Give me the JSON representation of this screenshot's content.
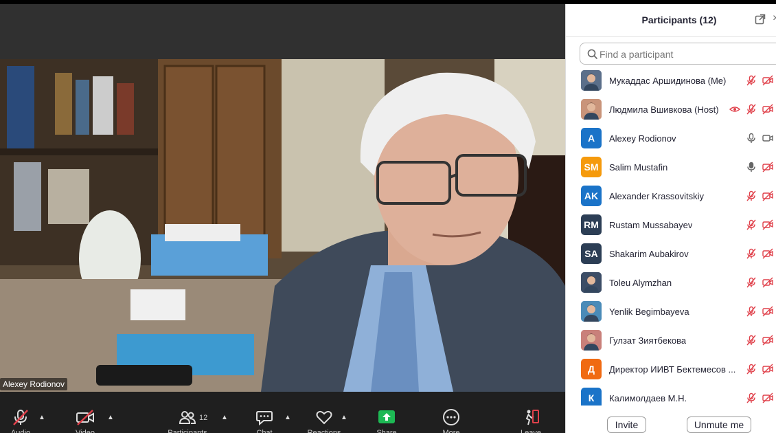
{
  "video": {
    "speaker_name": "Alexey Rodionov"
  },
  "toolbar": {
    "audio_label": "Audio",
    "video_label": "Video",
    "participants_label": "Participants",
    "participants_count": "12",
    "chat_label": "Chat",
    "reactions_label": "Reactions",
    "share_label": "Share",
    "more_label": "More",
    "leave_label": "Leave"
  },
  "panel": {
    "title": "Participants (12)",
    "search_placeholder": "Find a participant",
    "invite_label": "Invite",
    "unmute_label": "Unmute me"
  },
  "participants": [
    {
      "name": "Мукаддас Аршидинова (Me)",
      "avatar": "photo",
      "initials": "",
      "color": "#5b6f8a",
      "mic": "muted",
      "cam": "off"
    },
    {
      "name": "Людмила Вшивкова (Host)",
      "avatar": "photo",
      "initials": "",
      "color": "#c9947a",
      "mic": "muted",
      "cam": "off",
      "extra": "eye"
    },
    {
      "name": "Alexey Rodionov",
      "avatar": "initials",
      "initials": "A",
      "color": "#1a73c8",
      "mic": "on",
      "cam": "on"
    },
    {
      "name": "Salim Mustafin",
      "avatar": "initials",
      "initials": "SM",
      "color": "#f59a0c",
      "mic": "on",
      "cam": "off"
    },
    {
      "name": "Alexander Krassovitskiy",
      "avatar": "initials",
      "initials": "AK",
      "color": "#1a73c8",
      "mic": "muted",
      "cam": "off"
    },
    {
      "name": "Rustam Mussabayev",
      "avatar": "initials",
      "initials": "RM",
      "color": "#2c3e55",
      "mic": "muted",
      "cam": "off"
    },
    {
      "name": "Shakarim Aubakirov",
      "avatar": "initials",
      "initials": "SA",
      "color": "#2c3e55",
      "mic": "muted",
      "cam": "off"
    },
    {
      "name": "Toleu Alymzhan",
      "avatar": "photo",
      "initials": "",
      "color": "#3c4d66",
      "mic": "muted",
      "cam": "off"
    },
    {
      "name": "Yenlik Begimbayeva",
      "avatar": "photo",
      "initials": "",
      "color": "#4a8bb8",
      "mic": "muted",
      "cam": "off"
    },
    {
      "name": "Гулзат Зиятбекова",
      "avatar": "photo",
      "initials": "",
      "color": "#c9807a",
      "mic": "muted",
      "cam": "off"
    },
    {
      "name": "Директор ИИВТ Бектемесов ...",
      "avatar": "initials",
      "initials": "Д",
      "color": "#f06a12",
      "mic": "muted",
      "cam": "off"
    },
    {
      "name": "Калимолдаев М.Н.",
      "avatar": "initials",
      "initials": "К",
      "color": "#1a73c8",
      "mic": "muted",
      "cam": "off"
    }
  ]
}
